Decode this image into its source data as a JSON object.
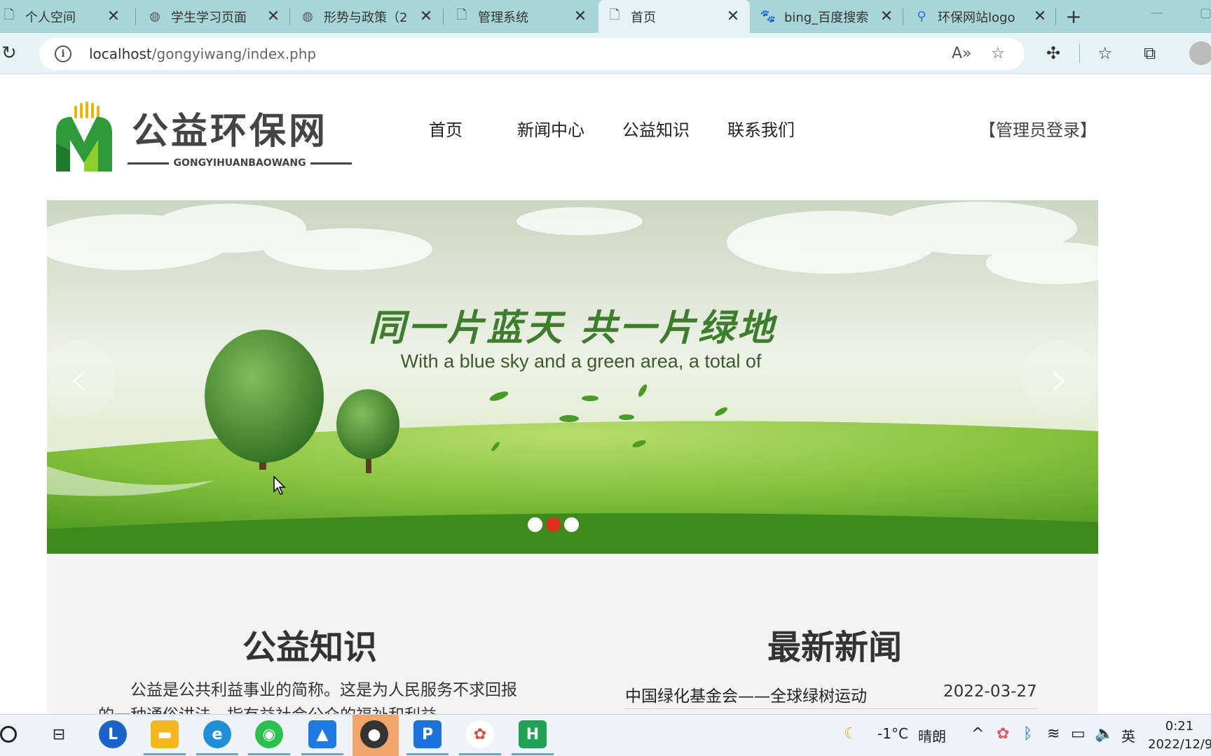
{
  "browser": {
    "tabs": [
      {
        "title": "个人空间",
        "icon": "page-icon"
      },
      {
        "title": "学生学习页面",
        "icon": "globe-icon"
      },
      {
        "title": "形势与政策（2",
        "icon": "globe-icon"
      },
      {
        "title": "管理系统",
        "icon": "page-icon"
      },
      {
        "title": "首页",
        "icon": "page-icon",
        "active": true
      },
      {
        "title": "bing_百度搜索",
        "icon": "baidu-icon"
      },
      {
        "title": "环保网站logo",
        "icon": "search-icon"
      }
    ],
    "url_host": "localhost",
    "url_path": "/gongyiwang/index.php"
  },
  "site": {
    "logo_title": "公益环保网",
    "logo_subtitle": "GONGYIHUANBAOWANG",
    "nav": [
      "首页",
      "新闻中心",
      "公益知识",
      "联系我们"
    ],
    "admin_login": "【管理员登录】"
  },
  "banner": {
    "title": "同一片蓝天  共一片绿地",
    "subtitle": "With a blue sky and a green area, a total of",
    "slide_count": 3,
    "active_slide": 2,
    "colors": {
      "sky": "#dfe8d6",
      "grass": "#7bbf3a",
      "dot_active": "#e0301e"
    }
  },
  "knowledge": {
    "heading": "公益知识",
    "text": "公益是公共利益事业的简称。这是为人民服务不求回报的一种通俗讲法，指有益社会公众的福祉和利益。"
  },
  "news": {
    "heading": "最新新闻",
    "items": [
      {
        "title": "中国绿化基金会——全球绿树运动",
        "date": "2022-03-27"
      }
    ]
  },
  "taskbar": {
    "weather": "-1°C",
    "weather_desc": "晴朗",
    "ime": "英",
    "time": "0:21",
    "date": "2022/12/9"
  }
}
